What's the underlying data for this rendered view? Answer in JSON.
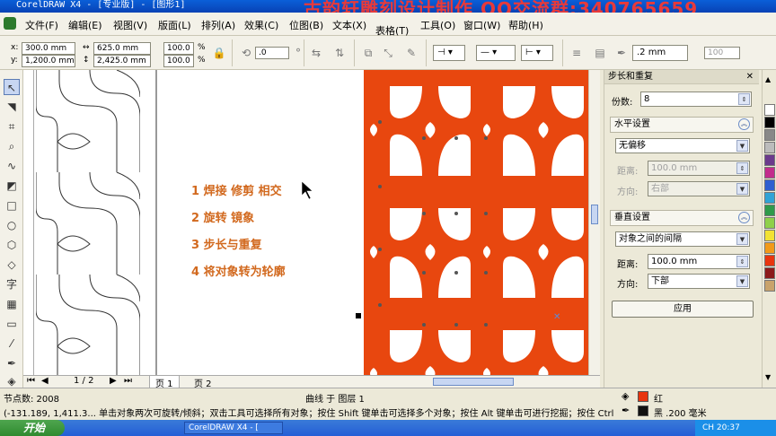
{
  "window": {
    "title": "CorelDRAW X4 - [专业版] - [图形1]",
    "overlay_text": "古韵轩雕刻设计制作 QQ交流群:340765659"
  },
  "menu": [
    "文件(F)",
    "编辑(E)",
    "视图(V)",
    "版面(L)",
    "排列(A)",
    "效果(C)",
    "位图(B)",
    "文本(X)",
    "表格(T)",
    "工具(O)",
    "窗口(W)",
    "帮助(H)"
  ],
  "propbar": {
    "x": "300.0 mm",
    "y": "1,200.0 mm",
    "width": "625.0 mm",
    "height": "2,425.0 mm",
    "scale_x": "100.0",
    "scale_y": "100.0",
    "percent": "%",
    "rotation": ".0",
    "outline_width": ".2 mm",
    "zoom_level": "100"
  },
  "steps": [
    "1  焊接 修剪 相交",
    "2  旋转 镜象",
    "3 步长与重复",
    "4 将对象转为轮廓"
  ],
  "pager": {
    "current": "1 / 2",
    "tabs": [
      "页 1",
      "页 2"
    ]
  },
  "docker": {
    "title": "步长和重复",
    "copies_label": "份数:",
    "copies_value": "8",
    "horizontal": {
      "title": "水平设置",
      "mode": "无偏移",
      "distance_label": "距离:",
      "distance_value": "100.0 mm",
      "direction_label": "方向:",
      "direction_value": "右部"
    },
    "vertical": {
      "title": "垂直设置",
      "mode": "对象之间的间隔",
      "distance_label": "距离:",
      "distance_value": "100.0 mm",
      "direction_label": "方向:",
      "direction_value": "下部"
    },
    "apply_label": "应用"
  },
  "status": {
    "nodes": "节点数: 2008",
    "object_info": "曲线 于 图层 1",
    "coords_hint": "(-131.189, 1,411.3...  单击对象两次可旋转/倾斜；双击工具可选择所有对象；按住 Shift 键单击可选择多个对象；按住 Alt 键单击可进行挖掘；按住 Ctrl ...",
    "fill_label": "红",
    "outline_label": "黑  .200 毫米"
  },
  "taskbar": {
    "start": "开始",
    "task": "CorelDRAW X4 - [",
    "tray": "CH  20:37"
  },
  "colors": {
    "pattern_orange": "#e8470f",
    "step_text": "#d2691e",
    "fill_red": "#e8350f",
    "outline_black": "#111111"
  },
  "palette": [
    "#ffffff",
    "#000000",
    "#888888",
    "#bcbcbc",
    "#6b3a8c",
    "#c22c8c",
    "#2f5fd0",
    "#31a3d6",
    "#2f9a4a",
    "#8fd04a",
    "#f2e233",
    "#f29a1a",
    "#e8350f",
    "#8c1a1a",
    "#c9a36b"
  ]
}
